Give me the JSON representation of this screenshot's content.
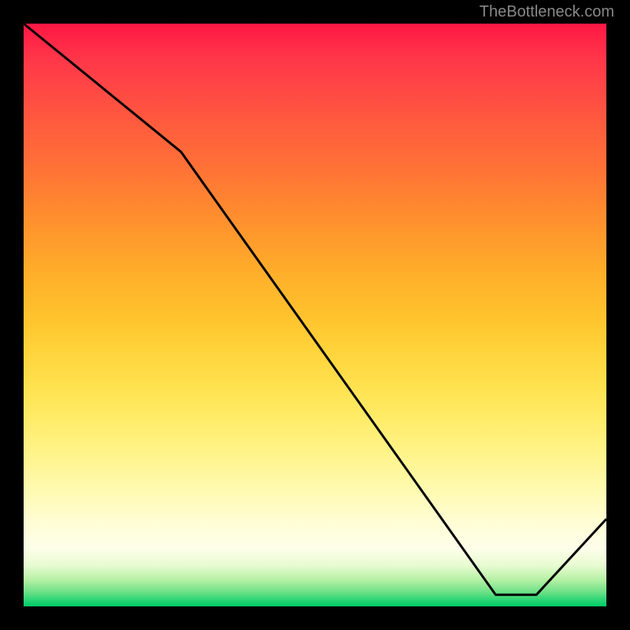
{
  "watermark": "TheBottleneck.com",
  "annotation_label": "",
  "chart_data": {
    "type": "line",
    "title": "",
    "xlabel": "",
    "ylabel": "",
    "x_range": [
      0,
      100
    ],
    "y_range": [
      0,
      100
    ],
    "series": [
      {
        "name": "curve",
        "x": [
          0,
          27,
          81,
          88,
          100
        ],
        "y": [
          100,
          78,
          2,
          2,
          15
        ],
        "note": "Values estimated from pixel positions; y is percentage of plot height from bottom. Curve starts top-left, descends with a slope change near x≈27, reaches a flat minimum around x≈81-88, then rises toward the right edge."
      }
    ],
    "background_gradient": {
      "type": "vertical",
      "colors_top_to_bottom": [
        "#ff1744",
        "#ff5e3d",
        "#ff9b2c",
        "#ffd33a",
        "#fff48b",
        "#fefeea",
        "#6ee187",
        "#00cc66"
      ]
    }
  }
}
